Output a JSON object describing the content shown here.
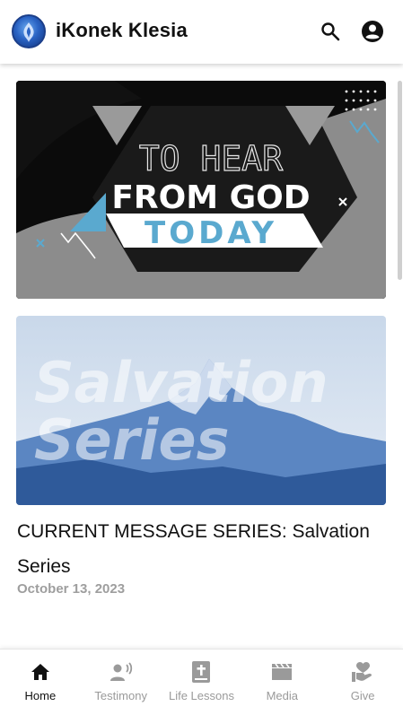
{
  "app": {
    "title": "iKonek Klesia"
  },
  "icons": {
    "logo": "church-logo",
    "search": "search-icon",
    "account": "account-circle-icon"
  },
  "banner1": {
    "line1": "TO HEAR",
    "line2": "FROM GOD",
    "line3": "TODAY",
    "accent": "#5aa9cf"
  },
  "banner2": {
    "line1": "Salvation",
    "line2": "Series",
    "tint": "#5b86c2"
  },
  "series": {
    "title": "CURRENT MESSAGE SERIES: Salvation Series",
    "date": "October 13, 2023"
  },
  "nav": {
    "active": "Home",
    "items": [
      {
        "label": "Home",
        "icon": "home-icon"
      },
      {
        "label": "Testimony",
        "icon": "speaker-person-icon"
      },
      {
        "label": "Life Lessons",
        "icon": "bible-icon"
      },
      {
        "label": "Media",
        "icon": "clapperboard-icon"
      },
      {
        "label": "Give",
        "icon": "heart-hand-icon"
      }
    ]
  }
}
